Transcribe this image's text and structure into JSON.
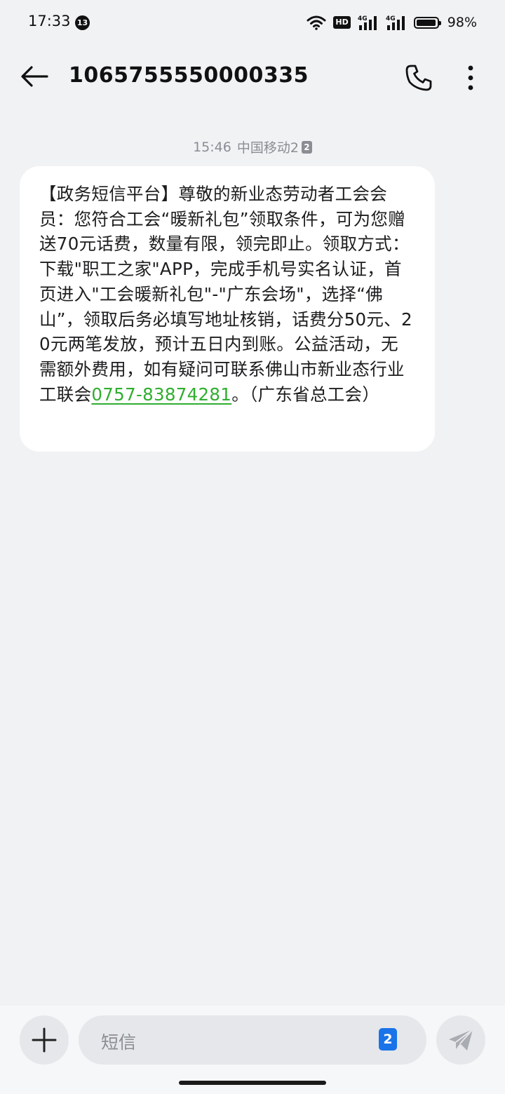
{
  "status_bar": {
    "time": "17:33",
    "notification_count": "13",
    "hd_label": "HD",
    "network_1": "4G",
    "network_2": "4G",
    "battery_level": 0.98,
    "battery_percent": "98%"
  },
  "header": {
    "title": "1065755550000335",
    "back_icon": "arrow-left-icon",
    "call_icon": "phone-icon",
    "more_icon": "more-vertical-icon"
  },
  "conversation": {
    "meta_time": "15:46",
    "meta_carrier": "中国移动2",
    "meta_sim": "2",
    "message_text_before_link": "【政务短信平台】尊敬的新业态劳动者工会会员：您符合工会“暖新礼包”领取条件，可为您赠送70元话费，数量有限，领完即止。领取方式：下载\"职工之家\"APP，完成手机号实名认证，首页进入\"工会暖新礼包\"-\"广东会场\"，选择“佛山”，领取后务必填写地址核销，话费分50元、20元两笔发放，预计五日内到账。公益活动，无需额外费用，如有疑问可联系佛山市新业态行业工联会",
    "message_link": "0757-83874281",
    "message_text_after_link": "。（广东省总工会）",
    "link_color": "#2fae2f"
  },
  "composer": {
    "add_icon": "plus-icon",
    "placeholder": "短信",
    "sim_selector": "2",
    "send_icon": "send-icon",
    "accent_color": "#1a73e8"
  }
}
